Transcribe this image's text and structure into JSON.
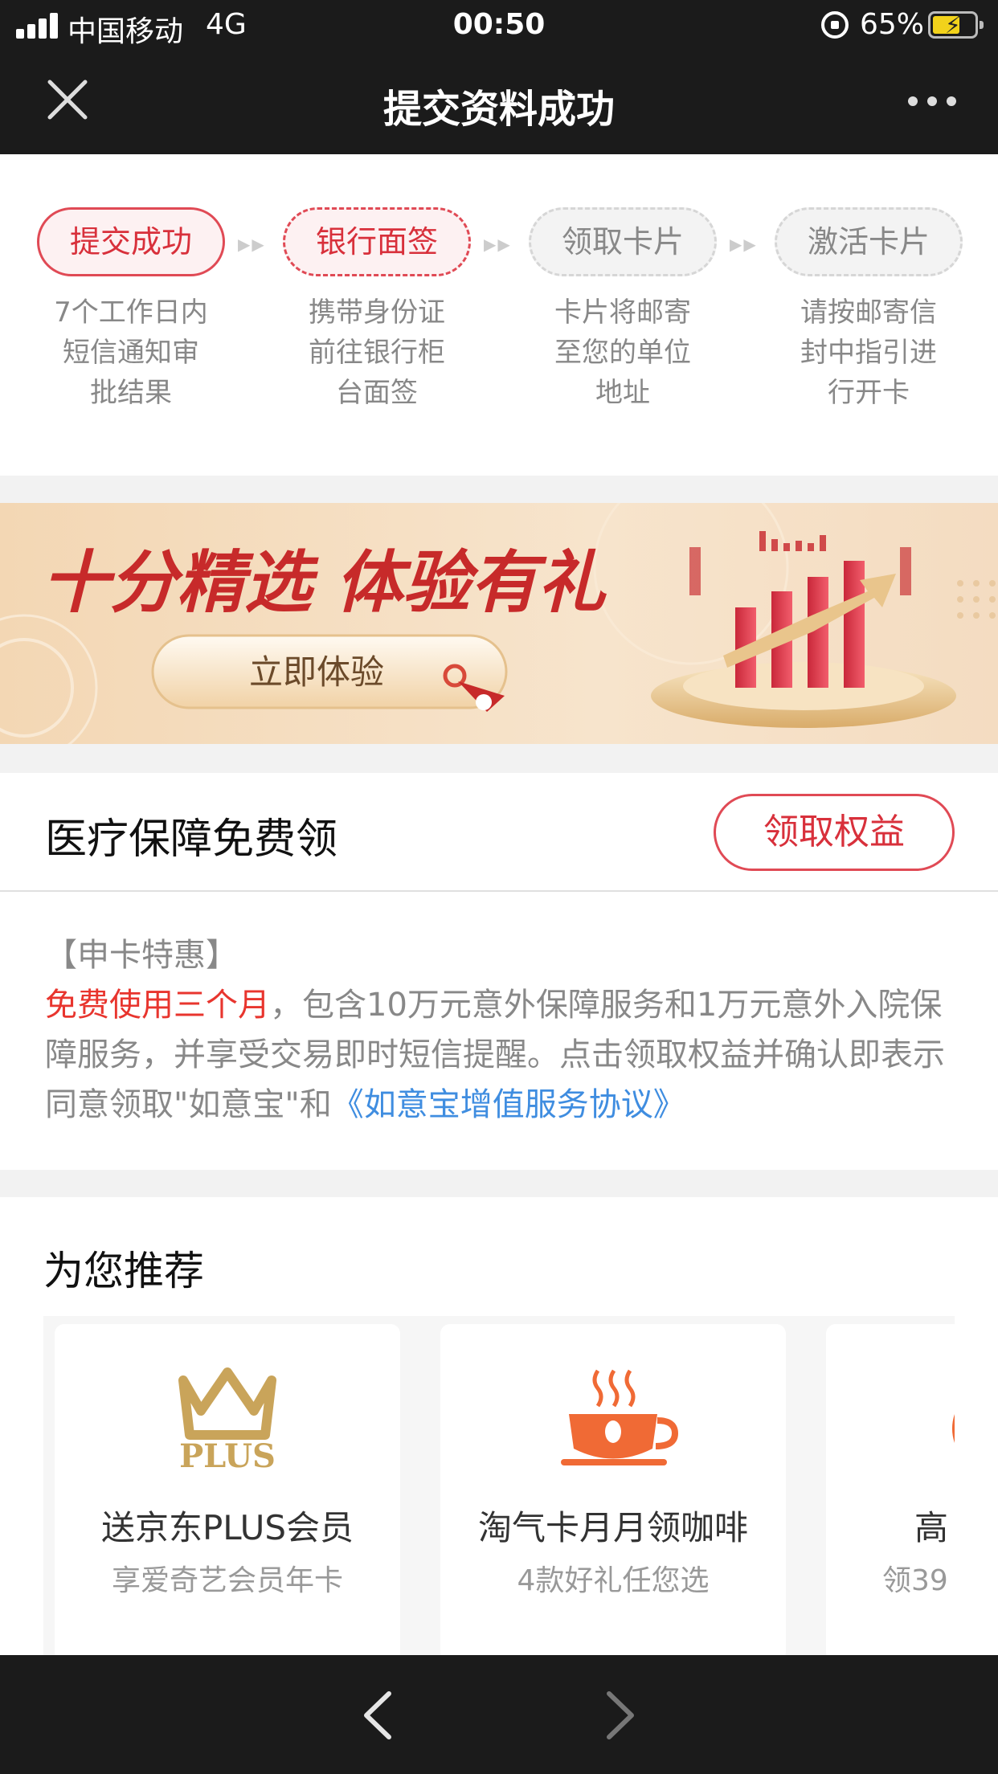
{
  "status_bar": {
    "carrier": "中国移动",
    "network": "4G",
    "time": "00:50",
    "battery": "65%",
    "battery_level": 0.65
  },
  "nav": {
    "title": "提交资料成功",
    "close_icon": "close-icon",
    "more_icon": "more-icon"
  },
  "steps": [
    {
      "label": "提交成功",
      "desc": [
        "7个工作日内",
        "短信通知审",
        "批结果"
      ],
      "state": "done"
    },
    {
      "label": "银行面签",
      "desc": [
        "携带身份证",
        "前往银行柜",
        "台面签"
      ],
      "state": "current"
    },
    {
      "label": "领取卡片",
      "desc": [
        "卡片将邮寄",
        "至您的单位",
        "地址"
      ],
      "state": "todo"
    },
    {
      "label": "激活卡片",
      "desc": [
        "请按邮寄信",
        "封中指引进",
        "行开卡"
      ],
      "state": "todo"
    }
  ],
  "banner": {
    "headline": "十分精选  体验有礼",
    "button": "立即体验"
  },
  "medical": {
    "title": "医疗保障免费领",
    "button": "领取权益",
    "tag": "【申卡特惠】",
    "highlight": "免费使用三个月",
    "body": "，包含10万元意外保障服务和1万元意外入院保障服务，并享受交易即时短信提醒。点击领取权益并确认即表示同意领取\"如意宝\"和",
    "link": "《如意宝增值服务协议》"
  },
  "recommend": {
    "title": "为您推荐",
    "items": [
      {
        "name": "送京东PLUS会员",
        "sub": "享爱奇艺会员年卡",
        "icon": "crown-plus-icon",
        "icon_text": "PLUS"
      },
      {
        "name": "淘气卡月月领咖啡",
        "sub": "4款好礼任您选",
        "icon": "coffee-cup-icon"
      },
      {
        "name": "高",
        "sub": "领39",
        "icon": "partial-icon"
      }
    ]
  },
  "bottom_bar": {
    "back_icon": "back-arrow-icon",
    "forward_icon": "forward-arrow-icon"
  },
  "colors": {
    "accent_red": "#d8303b",
    "link_blue": "#3f8de0",
    "dark_bar": "#1b1b1b"
  }
}
